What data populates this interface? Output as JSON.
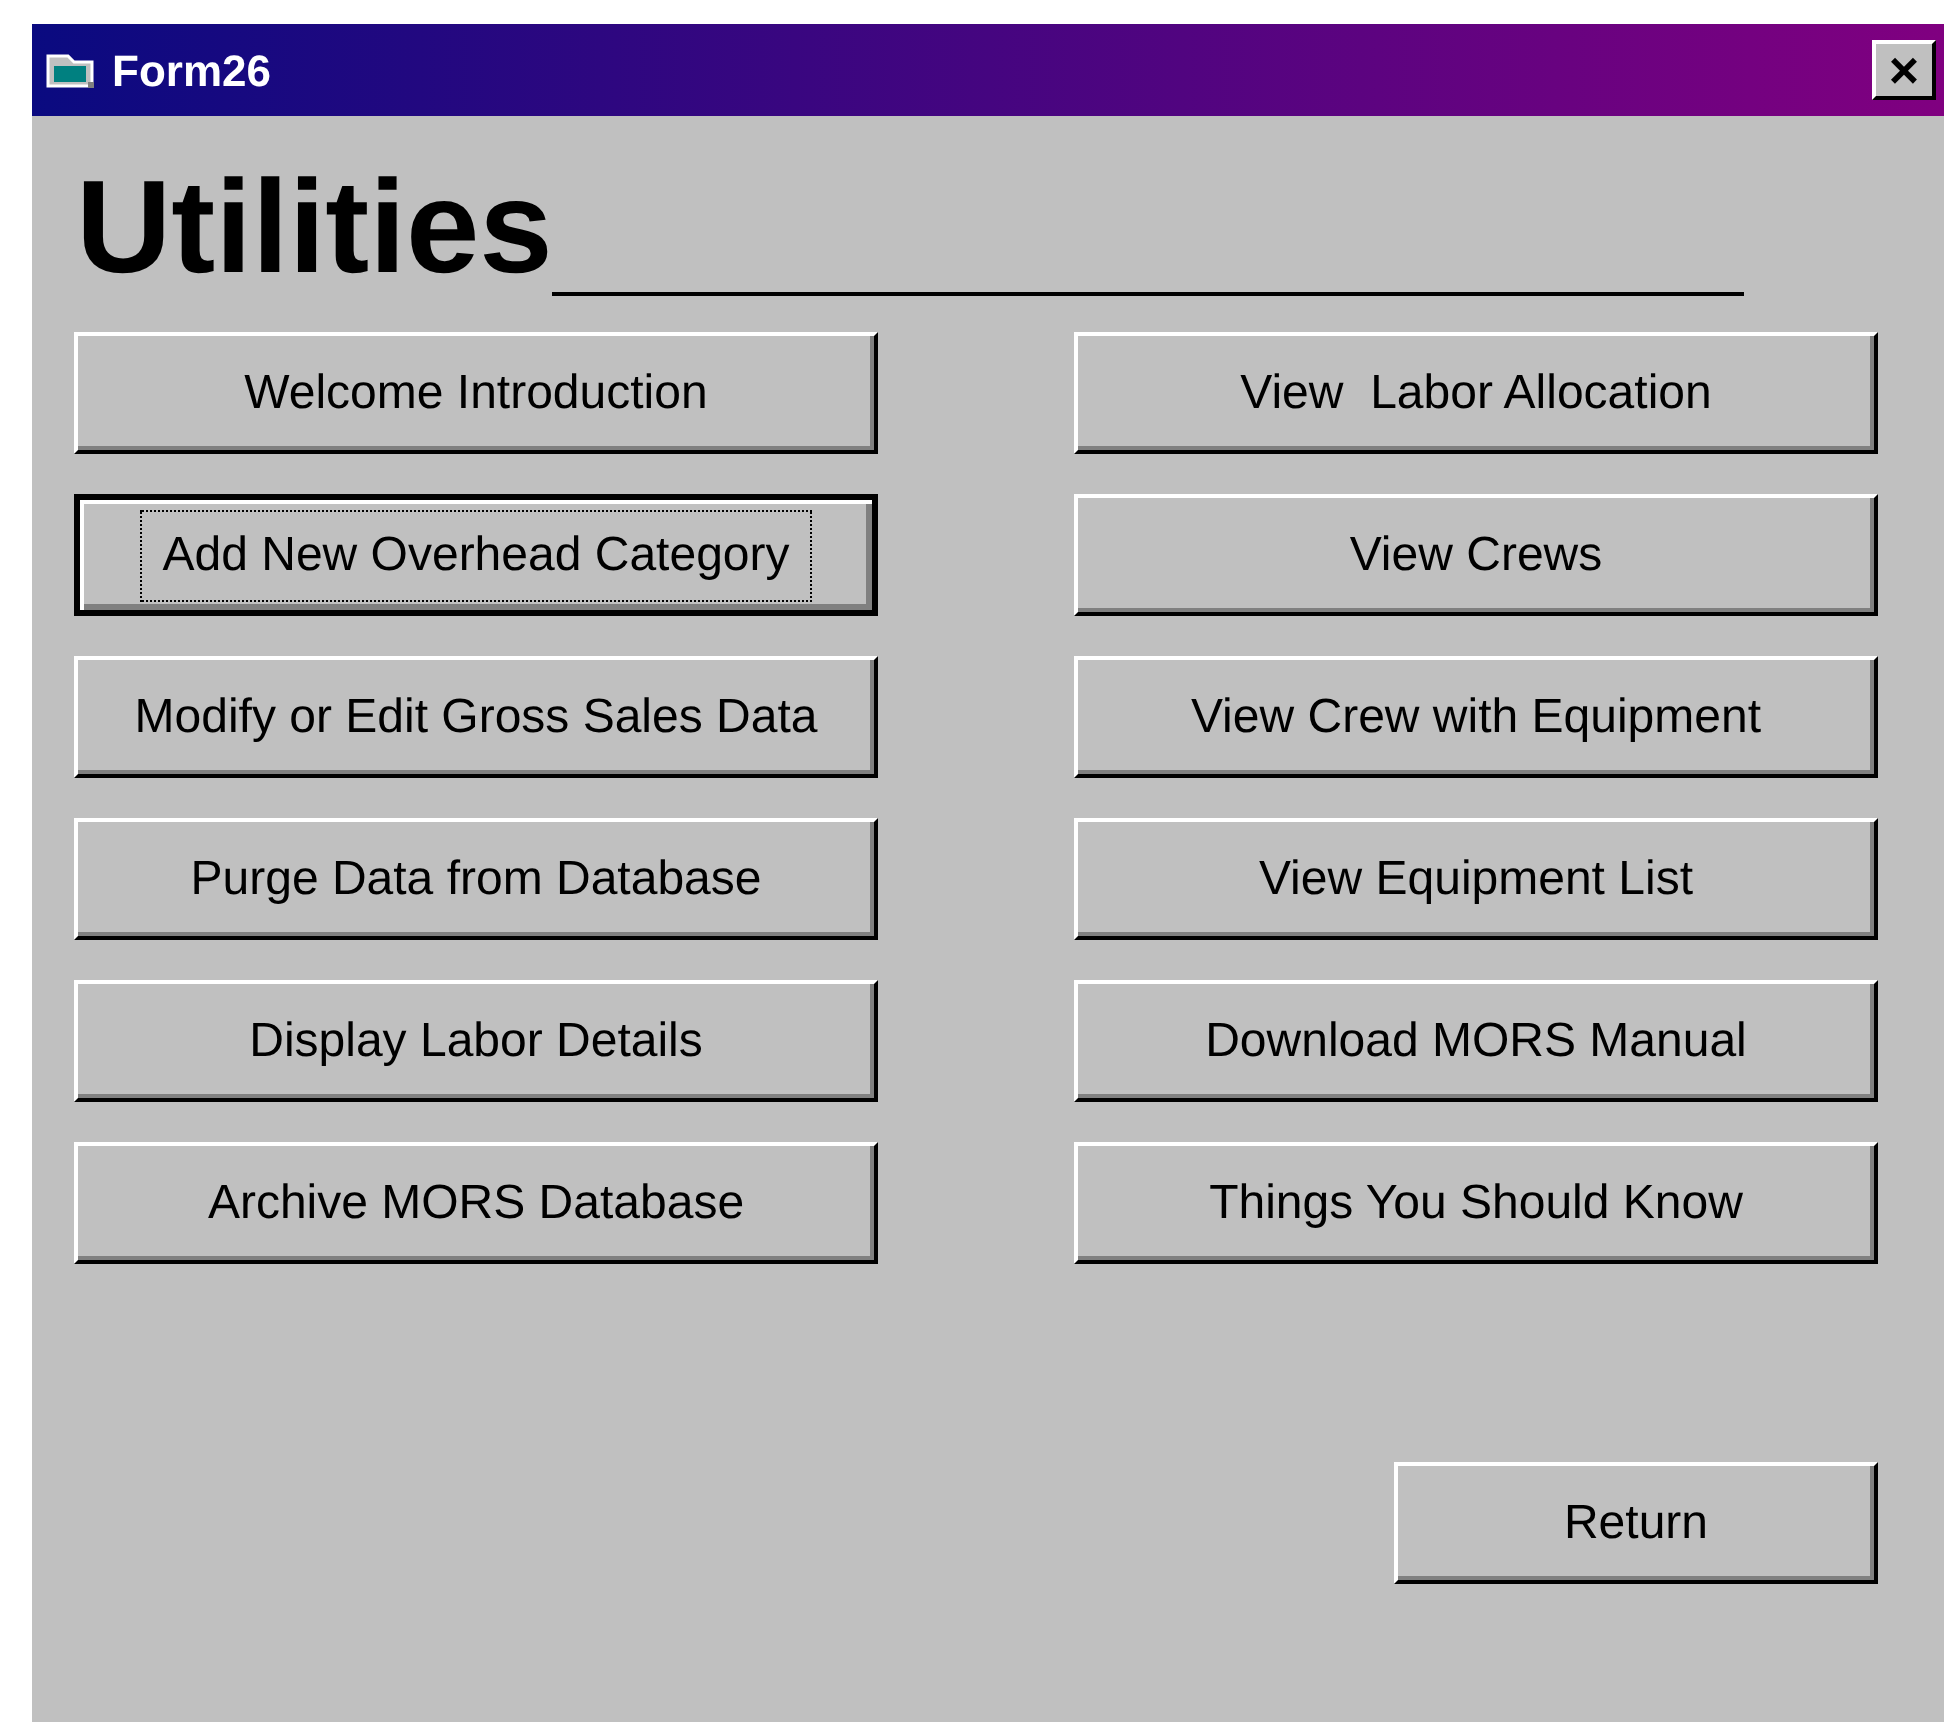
{
  "window": {
    "title": "Form26",
    "close": "×"
  },
  "heading": "Utilities",
  "buttons": [
    {
      "label": "Welcome Introduction",
      "focused": false
    },
    {
      "label": "View  Labor Allocation",
      "focused": false
    },
    {
      "label": "Add New Overhead Category",
      "focused": true
    },
    {
      "label": "View Crews",
      "focused": false
    },
    {
      "label": "Modify or Edit Gross Sales Data",
      "focused": false
    },
    {
      "label": "View Crew with Equipment",
      "focused": false
    },
    {
      "label": "Purge Data from Database",
      "focused": false
    },
    {
      "label": "View Equipment List",
      "focused": false
    },
    {
      "label": "Display Labor Details",
      "focused": false
    },
    {
      "label": "Download MORS Manual",
      "focused": false
    },
    {
      "label": "Archive MORS Database",
      "focused": false
    },
    {
      "label": "Things You Should Know",
      "focused": false
    }
  ],
  "return_button": "Return"
}
